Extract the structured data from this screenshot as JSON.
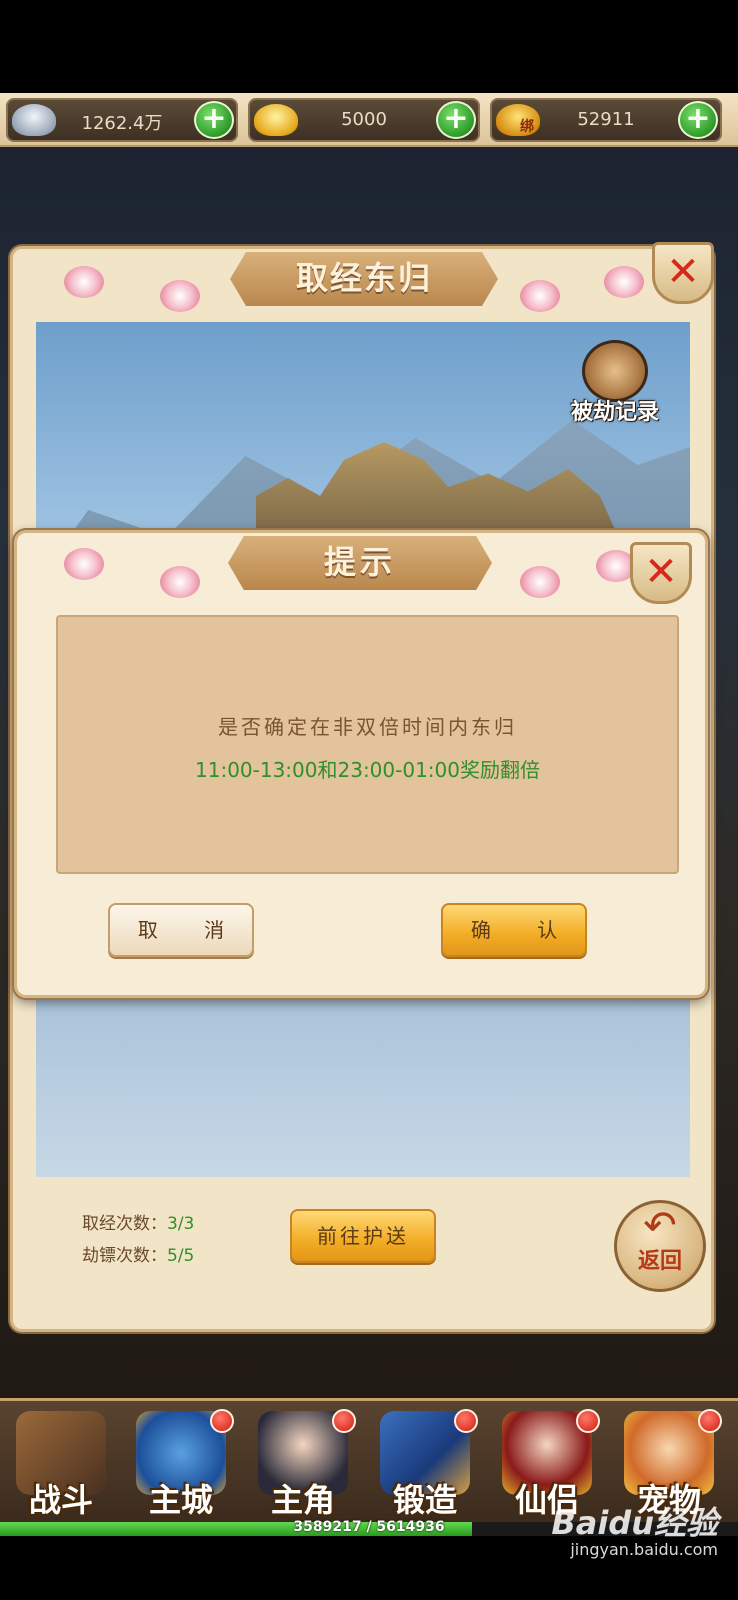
{
  "currencies": [
    {
      "name": "silver",
      "value": "1262.4万",
      "icon": "silver-ingot-icon"
    },
    {
      "name": "gold",
      "value": "5000",
      "icon": "gold-ingot-icon"
    },
    {
      "name": "bound-gold",
      "value": "52911",
      "icon": "bound-gold-icon",
      "tag": "绑"
    }
  ],
  "panel": {
    "title": "取经东归",
    "robbery_record_label": "被劫记录",
    "stats": {
      "scripture_label": "取经次数：",
      "scripture_value": "3/3",
      "robbery_label": "劫镖次数：",
      "robbery_value": "5/5"
    },
    "go_escort_label": "前往护送",
    "back_label": "返回"
  },
  "dialog": {
    "title": "提示",
    "message_line1": "是否确定在非双倍时间内东归",
    "message_line2": "11:00-13:00和23:00-01:00奖励翻倍",
    "cancel_label": "取 消",
    "confirm_label": "确 认"
  },
  "bottom_nav": [
    {
      "label": "战斗",
      "icon": "crossed-swords-icon",
      "badge": false
    },
    {
      "label": "主城",
      "icon": "city-icon",
      "badge": true
    },
    {
      "label": "主角",
      "icon": "hero-portrait-icon",
      "badge": true
    },
    {
      "label": "锻造",
      "icon": "forge-icon",
      "badge": true
    },
    {
      "label": "仙侣",
      "icon": "companion-portrait-icon",
      "badge": true
    },
    {
      "label": "宠物",
      "icon": "pet-monkey-icon",
      "badge": true
    }
  ],
  "experience": {
    "current": 3589217,
    "max": 5614936,
    "text": "3589217 / 5614936"
  },
  "watermark": {
    "line1": "Baidu经验",
    "line2": "jingyan.baidu.com"
  },
  "colors": {
    "accent_green": "#2f8f2a",
    "gold_button": "#f2ac25",
    "close_red": "#d8281c"
  }
}
